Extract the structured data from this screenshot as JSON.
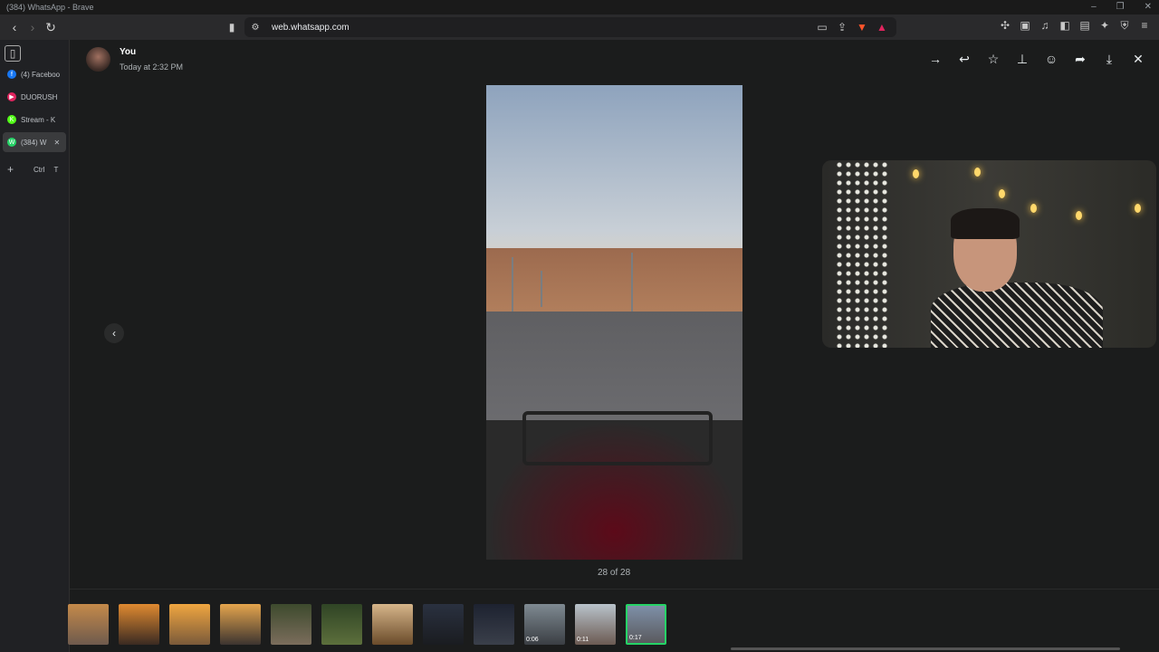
{
  "window": {
    "title": "(384) WhatsApp - Brave"
  },
  "browser": {
    "url": "web.whatsapp.com",
    "tabs": [
      {
        "label": "(4) Faceboo",
        "color": "#1877f2",
        "glyph": "f"
      },
      {
        "label": "DUORUSH",
        "color": "#e0245e",
        "glyph": "▶"
      },
      {
        "label": "Stream - K",
        "color": "#53fc18",
        "glyph": "K"
      },
      {
        "label": "(384) W",
        "color": "#25d366",
        "glyph": "W",
        "active": true
      }
    ],
    "new_tab_shortcut": {
      "icon": "+",
      "key1": "Ctrl",
      "key2": "T"
    }
  },
  "viewer": {
    "sender_name": "You",
    "timestamp": "Today at 2:32 PM",
    "counter": "28 of 28",
    "actions": [
      "go-to-message",
      "reply",
      "star",
      "pin",
      "react",
      "forward",
      "download",
      "close"
    ]
  },
  "thumbnails": [
    {
      "colors": [
        "#c58a4a",
        "#6e5a4d"
      ]
    },
    {
      "colors": [
        "#e08a30",
        "#3a2a22"
      ]
    },
    {
      "colors": [
        "#f0a640",
        "#7a5a3a"
      ]
    },
    {
      "colors": [
        "#e5a54d",
        "#3c3430"
      ]
    },
    {
      "colors": [
        "#3d4a2d",
        "#7b6d5c"
      ]
    },
    {
      "colors": [
        "#2f4425",
        "#5c6f3c"
      ]
    },
    {
      "colors": [
        "#d6b58a",
        "#6a4b2a"
      ]
    },
    {
      "colors": [
        "#2a3140",
        "#1a1c20"
      ]
    },
    {
      "colors": [
        "#1d2230",
        "#3a3f4a"
      ]
    },
    {
      "colors": [
        "#7f8a92",
        "#3a3e43"
      ],
      "duration": "0:06"
    },
    {
      "colors": [
        "#b9c3cb",
        "#6b5a52"
      ],
      "duration": "0:11"
    },
    {
      "colors": [
        "#7e90a8",
        "#5a5a5e"
      ],
      "duration": "0:17",
      "selected": true
    }
  ]
}
